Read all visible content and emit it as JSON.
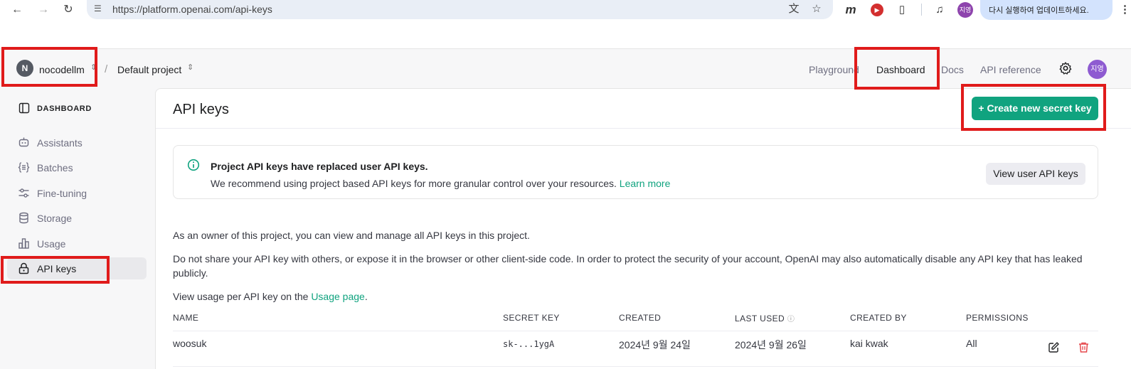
{
  "browser": {
    "url": "https://platform.openai.com/api-keys",
    "profile_label": "지영",
    "update_label": "다시 실행하여 업데이트하세요.",
    "ext_m_label": "m"
  },
  "topbar": {
    "org_initial": "N",
    "org_name": "nocodellm",
    "separator": "/",
    "project_name": "Default project",
    "links": [
      "Playground",
      "Dashboard",
      "Docs",
      "API reference"
    ],
    "active_link": "Dashboard",
    "user_avatar": "지영"
  },
  "sidebar": {
    "heading": "DASHBOARD",
    "items": [
      {
        "label": "Assistants",
        "icon": "robot-icon"
      },
      {
        "label": "Batches",
        "icon": "batches-icon"
      },
      {
        "label": "Fine-tuning",
        "icon": "sliders-icon"
      },
      {
        "label": "Storage",
        "icon": "database-icon"
      },
      {
        "label": "Usage",
        "icon": "bar-chart-icon"
      },
      {
        "label": "API keys",
        "icon": "lock-icon",
        "active": true
      }
    ]
  },
  "main": {
    "title": "API keys",
    "create_button": "Create new secret key",
    "notice": {
      "title": "Project API keys have replaced user API keys.",
      "body": "We recommend using project based API keys for more granular control over your resources.",
      "learn_more": "Learn more",
      "button": "View user API keys"
    },
    "para1": "As an owner of this project, you can view and manage all API keys in this project.",
    "para2": "Do not share your API key with others, or expose it in the browser or other client-side code. In order to protect the security of your account, OpenAI may also automatically disable any API key that has leaked publicly.",
    "para3_prefix": "View usage per API key on the",
    "para3_link": "Usage page",
    "para3_suffix": "."
  },
  "table": {
    "headers": [
      "NAME",
      "SECRET KEY",
      "CREATED",
      "LAST USED",
      "CREATED BY",
      "PERMISSIONS"
    ],
    "rows": [
      {
        "name": "woosuk",
        "secret_key": "sk-...1ygA",
        "created": "2024년 9월 24일",
        "last_used": "2024년 9월 26일",
        "created_by": "kai kwak",
        "permissions": "All"
      }
    ]
  },
  "colors": {
    "accent": "#10a37f",
    "annotation": "#e01b1b"
  }
}
